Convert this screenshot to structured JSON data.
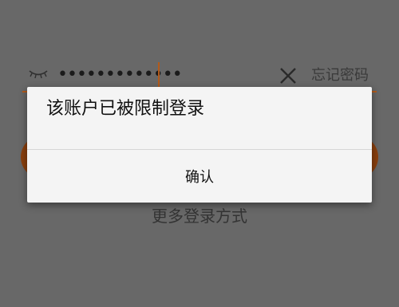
{
  "login": {
    "password_value": "•••••••••••••",
    "forgot_password_label": "忘记密码",
    "more_login_label": "更多登录方式",
    "eye_icon": "closed-eye-icon",
    "clear_icon": "close-icon"
  },
  "dialog": {
    "message": "该账户已被限制登录",
    "confirm_label": "确认"
  },
  "colors": {
    "accent": "#b35a1a",
    "overlay_background": "#686868",
    "dialog_background": "#f4f4f4"
  }
}
